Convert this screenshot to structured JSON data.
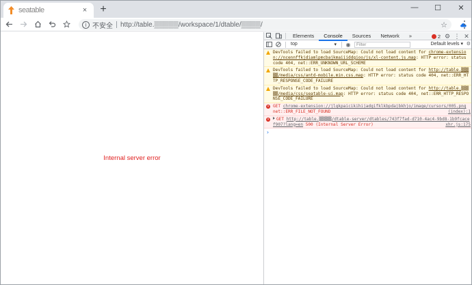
{
  "tab": {
    "title": "seatable",
    "close_label": "×",
    "new_tab_label": "+"
  },
  "window_controls": {
    "minimize": "—",
    "maximize": "☐",
    "close": "✕"
  },
  "toolbar": {
    "insecure_label": "不安全",
    "url": "http://table.▒▒▒▒▒/workspace/1/dtable/▒▒▒▒/"
  },
  "page": {
    "error_text": "Internal server error"
  },
  "devtools": {
    "tabs": [
      "Elements",
      "Console",
      "Sources",
      "Network"
    ],
    "more_tabs": "»",
    "active_tab": "Console",
    "error_count": "2",
    "context": "top",
    "filter_placeholder": "Filter",
    "levels_label": "Default levels",
    "messages": [
      {
        "type": "warning",
        "text": "DevTools failed to load SourceMap: Could not load content for ",
        "link": "chrome-extension://ncennffkjdiamlpmcbajkmaiiiddgioo/js/xl-content.js.map",
        "suffix": ": HTTP error: status code 404, net::ERR_UNKNOWN_URL_SCHEME"
      },
      {
        "type": "warning",
        "text": "DevTools failed to load SourceMap: Could not load content for ",
        "link": "http://table.▒▒▒▒▒/media/css/antd-mobile.min.css.map",
        "suffix": ": HTTP error: status code 404, net::ERR_HTTP_RESPONSE_CODE_FAILURE"
      },
      {
        "type": "warning",
        "text": "DevTools failed to load SourceMap: Could not load content for ",
        "link": "http://table.▒▒▒▒▒/media/css/seatable-ui.map",
        "suffix": ": HTTP error: status code 404, net::ERR_HTTP_RESPONSE_CODE_FAILURE"
      },
      {
        "type": "error",
        "text": "GET ",
        "link": "chrome-extension://jlgkpaicikihijadgifklkbpdajbkhjo/image/cursors/005.png",
        "source": "(index):1",
        "suffix": " net::ERR_FILE_NOT_FOUND"
      },
      {
        "type": "error",
        "text": "GET ",
        "link": "http://table.▒▒▒▒▒/dtable-server/dtables/743f7fad-d710-4ac4-9bd8-1b9fcacef907?lang=en",
        "source": "xhr.js:175",
        "suffix": " 500 (Internal Server Error)"
      }
    ],
    "prompt": "›"
  }
}
